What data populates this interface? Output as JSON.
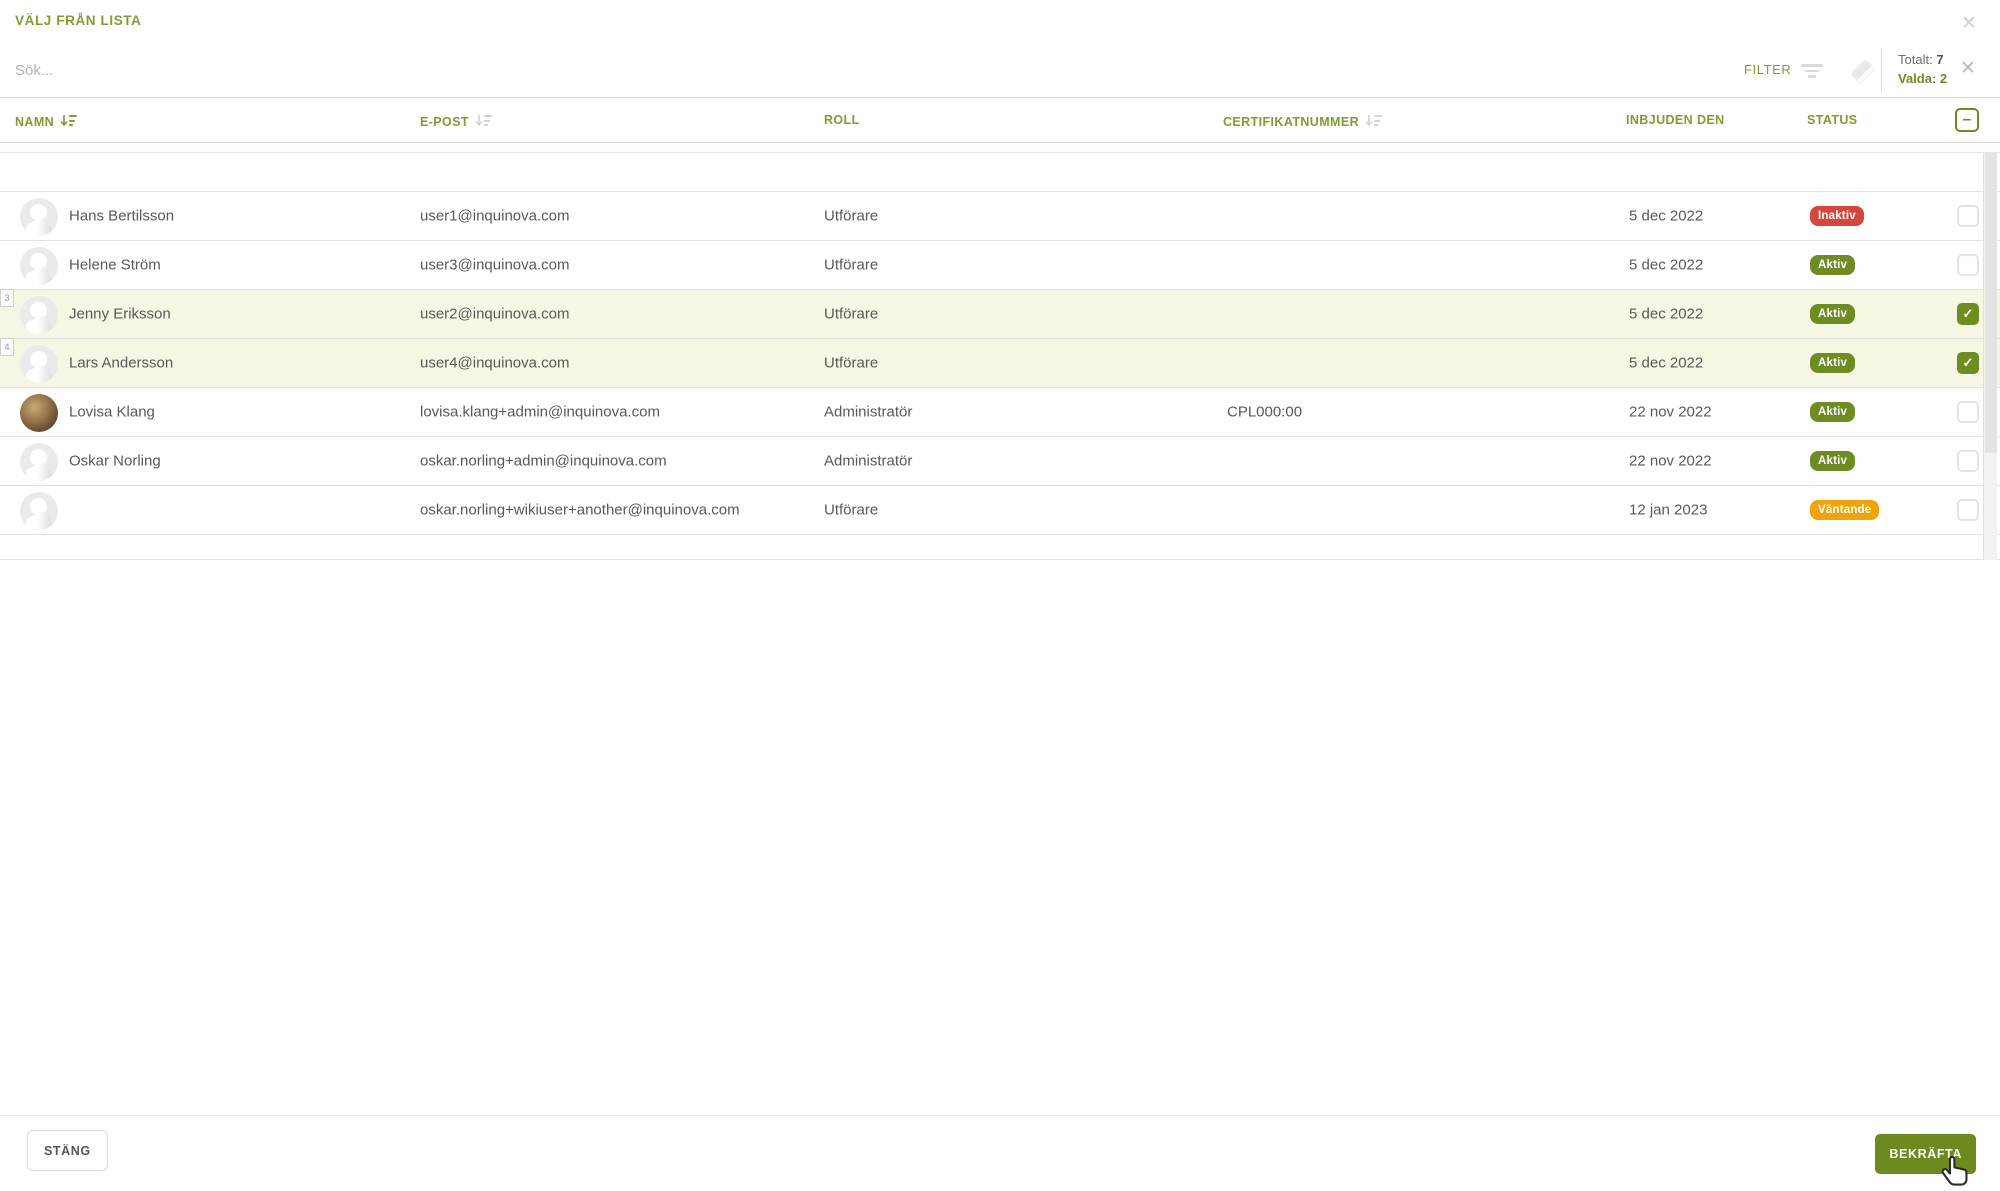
{
  "modal": {
    "title": "VÄLJ FRÅN LISTA"
  },
  "toolbar": {
    "search_placeholder": "Sök...",
    "filter_label": "FILTER",
    "total_label": "Totalt:",
    "total_value": "7",
    "selected_label": "Valda:",
    "selected_value": "2",
    "icons": [
      "close-icon",
      "filter-lines-icon",
      "eraser-icon",
      "clear-selection-x-icon"
    ]
  },
  "table": {
    "headers": {
      "name": "NAMN",
      "email": "E-POST",
      "role": "ROLL",
      "certificate": "CERTIFIKATNUMMER",
      "invited": "INBJUDEN DEN",
      "status": "STATUS"
    },
    "sort": {
      "name": "active-desc",
      "email": "inactive",
      "certificate": "inactive"
    },
    "header_checkbox_state": "indeterminate",
    "rows": [
      {
        "name": "Hans Bertilsson",
        "email": "user1@inquinova.com",
        "role": "Utförare",
        "certificate": "",
        "invited": "5 dec 2022",
        "status": "Inaktiv",
        "status_type": "inactive",
        "selected": false,
        "highlighted": false,
        "avatar": "placeholder",
        "marker": ""
      },
      {
        "name": "Helene Ström",
        "email": "user3@inquinova.com",
        "role": "Utförare",
        "certificate": "",
        "invited": "5 dec 2022",
        "status": "Aktiv",
        "status_type": "active",
        "selected": false,
        "highlighted": false,
        "avatar": "placeholder",
        "marker": ""
      },
      {
        "name": "Jenny Eriksson",
        "email": "user2@inquinova.com",
        "role": "Utförare",
        "certificate": "",
        "invited": "5 dec 2022",
        "status": "Aktiv",
        "status_type": "active",
        "selected": true,
        "highlighted": true,
        "avatar": "placeholder",
        "marker": "3"
      },
      {
        "name": "Lars Andersson",
        "email": "user4@inquinova.com",
        "role": "Utförare",
        "certificate": "",
        "invited": "5 dec 2022",
        "status": "Aktiv",
        "status_type": "active",
        "selected": true,
        "highlighted": true,
        "avatar": "placeholder",
        "marker": "4"
      },
      {
        "name": "Lovisa Klang",
        "email": "lovisa.klang+admin@inquinova.com",
        "role": "Administratör",
        "certificate": "CPL000:00",
        "invited": "22 nov 2022",
        "status": "Aktiv",
        "status_type": "active",
        "selected": false,
        "highlighted": false,
        "avatar": "photo",
        "marker": ""
      },
      {
        "name": "Oskar Norling",
        "email": "oskar.norling+admin@inquinova.com",
        "role": "Administratör",
        "certificate": "",
        "invited": "22 nov 2022",
        "status": "Aktiv",
        "status_type": "active",
        "selected": false,
        "highlighted": false,
        "avatar": "placeholder",
        "marker": ""
      },
      {
        "name": "",
        "email": "oskar.norling+wikiuser+another@inquinova.com",
        "role": "Utförare",
        "certificate": "",
        "invited": "12 jan 2023",
        "status": "Väntande",
        "status_type": "pending",
        "selected": false,
        "highlighted": false,
        "avatar": "placeholder",
        "marker": ""
      }
    ]
  },
  "footer": {
    "close_label": "STÄNG",
    "confirm_label": "BEKRÄFTA"
  },
  "glyphs": {
    "close": "✕",
    "check": "✓",
    "indeterminate": "–"
  },
  "colors": {
    "accent_green": "#6f8c23",
    "header_green": "#7e9d33",
    "status_active": "#6f8c23",
    "status_inactive": "#d5463d",
    "status_pending": "#f0a30b",
    "row_highlight": "#f5f7e4",
    "confirm_button": "#6d8a1f"
  }
}
